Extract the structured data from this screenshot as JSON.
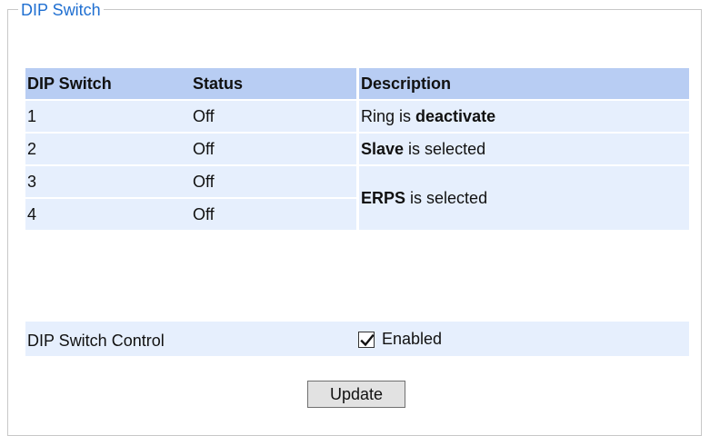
{
  "panel": {
    "legend": "DIP Switch"
  },
  "table": {
    "headers": [
      "DIP Switch",
      "Status",
      "Description"
    ],
    "rows": [
      {
        "switch": "1",
        "status": "Off",
        "desc_prefix": "Ring is ",
        "desc_bold": "deactivate",
        "desc_suffix": ""
      },
      {
        "switch": "2",
        "status": "Off",
        "desc_prefix": "",
        "desc_bold": "Slave",
        "desc_suffix": " is selected"
      },
      {
        "switch": "3",
        "status": "Off"
      },
      {
        "switch": "4",
        "status": "Off"
      }
    ],
    "merged_desc": {
      "desc_prefix": "",
      "desc_bold": "ERPS",
      "desc_suffix": " is selected"
    }
  },
  "control": {
    "label": "DIP Switch Control",
    "checkbox_label": "Enabled",
    "checked": true
  },
  "actions": {
    "update_label": "Update"
  }
}
